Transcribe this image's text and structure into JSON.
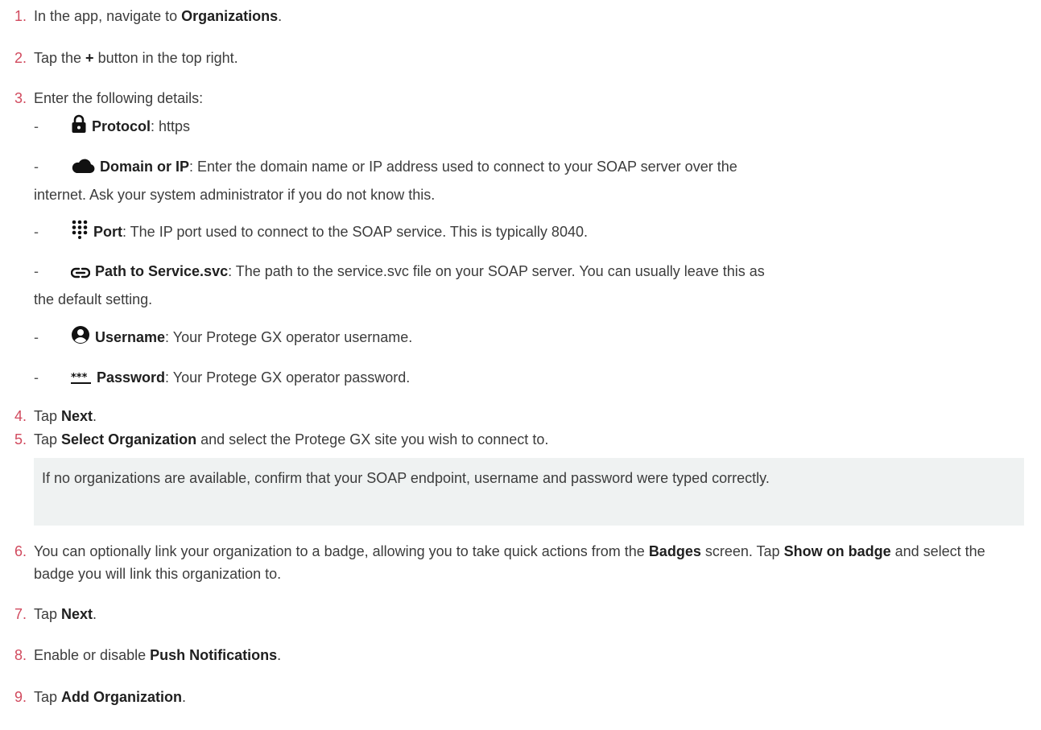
{
  "steps": [
    {
      "num": "1.",
      "pre": "In the app, navigate to ",
      "b1": "Organizations",
      "post": "."
    },
    {
      "num": "2.",
      "pre": "Tap the ",
      "b1": "+",
      "post": " button in the top right."
    },
    {
      "num": "3.",
      "text": "Enter the following details:"
    },
    {
      "num": "4.",
      "pre": "Tap ",
      "b1": "Next",
      "post": "."
    },
    {
      "num": "5.",
      "pre": "Tap ",
      "b1": "Select Organization",
      "post": " and select the Protege GX site you wish to connect to."
    },
    {
      "num": "6.",
      "pre": "You can optionally link your organization to a badge, allowing you to take quick actions from the ",
      "b1": "Badges",
      "mid": " screen. Tap ",
      "b2": "Show on badge",
      "post": " and select the badge you will link this organization to."
    },
    {
      "num": "7.",
      "pre": "Tap ",
      "b1": "Next",
      "post": "."
    },
    {
      "num": "8.",
      "pre": "Enable or disable ",
      "b1": "Push Notifications",
      "post": "."
    },
    {
      "num": "9.",
      "pre": "Tap ",
      "b1": "Add Organization",
      "post": "."
    }
  ],
  "details": [
    {
      "dash": "-",
      "icon": "lock-icon",
      "label": "Protocol",
      "text": ": https"
    },
    {
      "dash": "-",
      "icon": "cloud-icon",
      "label": "Domain or IP",
      "text": ": Enter the domain name or IP address used to connect to your SOAP server over the",
      "cont": "internet. Ask your system administrator if you do not know this."
    },
    {
      "dash": "-",
      "icon": "keypad-icon",
      "label": "Port",
      "text": ": The IP port used to connect to the SOAP service. This is typically 8040."
    },
    {
      "dash": "-",
      "icon": "link-icon",
      "label": "Path to Service.svc",
      "text": ": The path to the service.svc file on your SOAP server. You can usually leave this as",
      "cont": "the default setting."
    },
    {
      "dash": "-",
      "icon": "user-circle-icon",
      "label": "Username",
      "text": ": Your Protege GX operator username."
    },
    {
      "dash": "-",
      "icon": "password-icon",
      "label": "Password",
      "text": ": Your Protege GX operator password."
    }
  ],
  "note": "If no organizations are available, confirm that your SOAP endpoint, username and password were typed correctly.",
  "colors": {
    "number": "#d14a5e",
    "text": "#3c3c3c",
    "note_bg": "#eff2f2"
  }
}
